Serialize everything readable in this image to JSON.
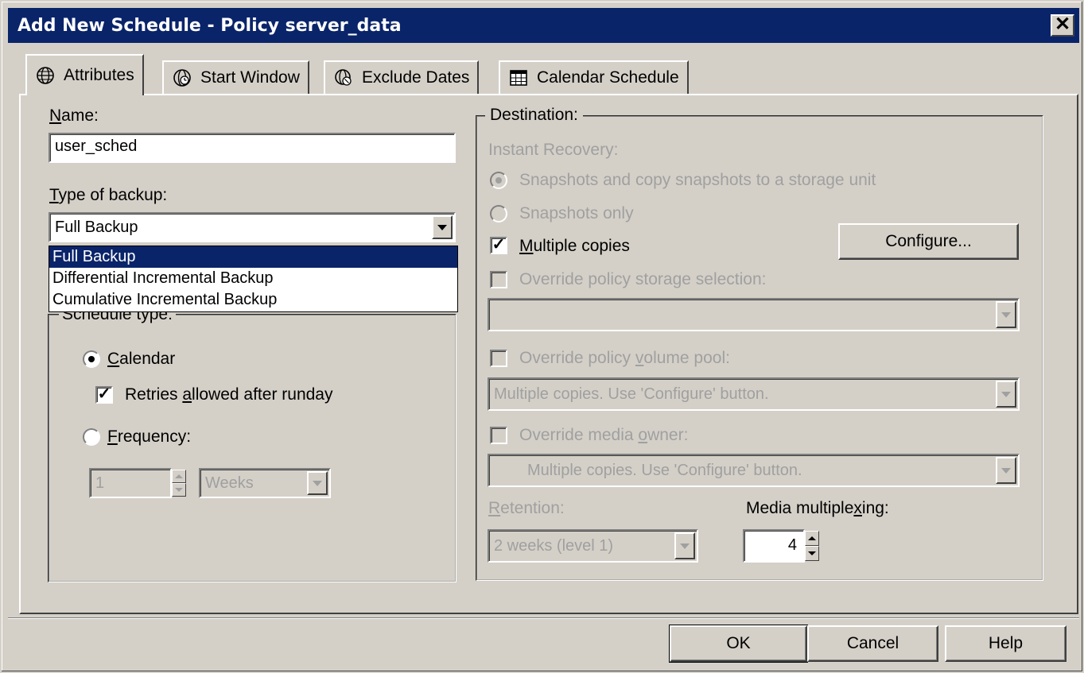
{
  "window": {
    "title": "Add New Schedule - Policy server_data",
    "close_glyph": "✕"
  },
  "tabs": [
    {
      "label": "Attributes",
      "icon": "globe-clock-icon"
    },
    {
      "label": "Start Window",
      "icon": "clock-globe-icon"
    },
    {
      "label": "Exclude Dates",
      "icon": "calendar-exclude-icon"
    },
    {
      "label": "Calendar Schedule",
      "icon": "calendar-icon"
    }
  ],
  "attributes": {
    "name_label_u": "N",
    "name_label_rest": "ame:",
    "name_value": "user_sched",
    "type_label_u": "T",
    "type_label_rest": "ype of backup:",
    "type_value": "Full Backup",
    "type_options": [
      "Full Backup",
      "Differential Incremental Backup",
      "Cumulative Incremental Backup"
    ],
    "schedule_type_label": "Schedule type:",
    "calendar_label_u": "C",
    "calendar_label_rest": "alendar",
    "retries_pre": "Retries ",
    "retries_u": "a",
    "retries_post": "llowed after runday",
    "frequency_label_u": "F",
    "frequency_label_rest": "requency:",
    "frequency_value": "1",
    "frequency_unit": "Weeks"
  },
  "destination": {
    "label": "Destination:",
    "instant_recovery_label": "Instant Recovery:",
    "snap_copy_label": "Snapshots and copy snapshots to a storage unit",
    "snap_only_label": "Snapshots only",
    "multiple_copies_u": "M",
    "multiple_copies_rest": "ultiple copies",
    "configure_pre": "Confi",
    "configure_u": "g",
    "configure_post": "ure...",
    "override_storage_label": "Override policy storage selection:",
    "storage_value": "",
    "override_volume_pre": "Override policy ",
    "override_volume_u": "v",
    "override_volume_post": "olume pool:",
    "volume_value": "Multiple copies.  Use 'Configure' button.",
    "override_media_pre": "Override media ",
    "override_media_u": "o",
    "override_media_post": "wner:",
    "media_value": "Multiple copies.  Use 'Configure' button.",
    "retention_u": "R",
    "retention_rest": "etention:",
    "retention_value": "2 weeks (level 1)",
    "multiplex_pre": "Media multiple",
    "multiplex_u": "x",
    "multiplex_post": "ing:",
    "multiplex_value": "4"
  },
  "buttons": {
    "ok": "OK",
    "cancel": "Cancel",
    "help": "Help"
  },
  "colors": {
    "titlebar": "#0a246a",
    "face": "#d4d0c8",
    "disabled_text": "#a0a0a0"
  }
}
